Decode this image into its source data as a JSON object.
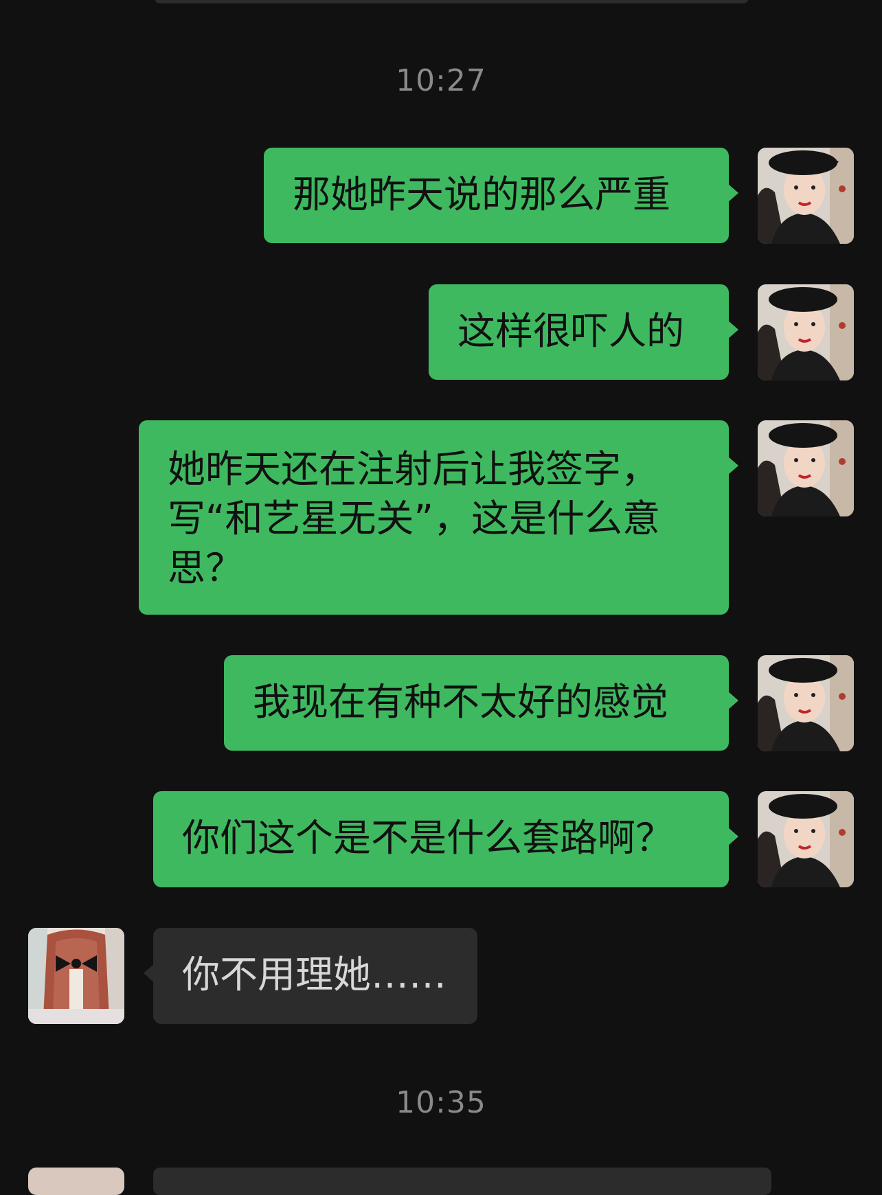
{
  "colors": {
    "background": "#111111",
    "outgoing_bubble": "#3fb960",
    "incoming_bubble": "#2c2c2c",
    "timestamp_text": "#8a8a8a"
  },
  "timestamps": [
    "10:27",
    "10:35"
  ],
  "messages": [
    {
      "side": "right",
      "text": "那她昨天说的那么严重"
    },
    {
      "side": "right",
      "text": "这样很吓人的"
    },
    {
      "side": "right",
      "text": "她昨天还在注射后让我签字，写“和艺星无关”，这是什么意思？"
    },
    {
      "side": "right",
      "text": "我现在有种不太好的感觉"
    },
    {
      "side": "right",
      "text": "你们这个是不是什么套路啊？"
    },
    {
      "side": "left",
      "text": "你不用理她……"
    }
  ],
  "avatars": {
    "self": "woman-in-black-beret-avatar",
    "contact": "red-hair-ribbon-avatar"
  }
}
